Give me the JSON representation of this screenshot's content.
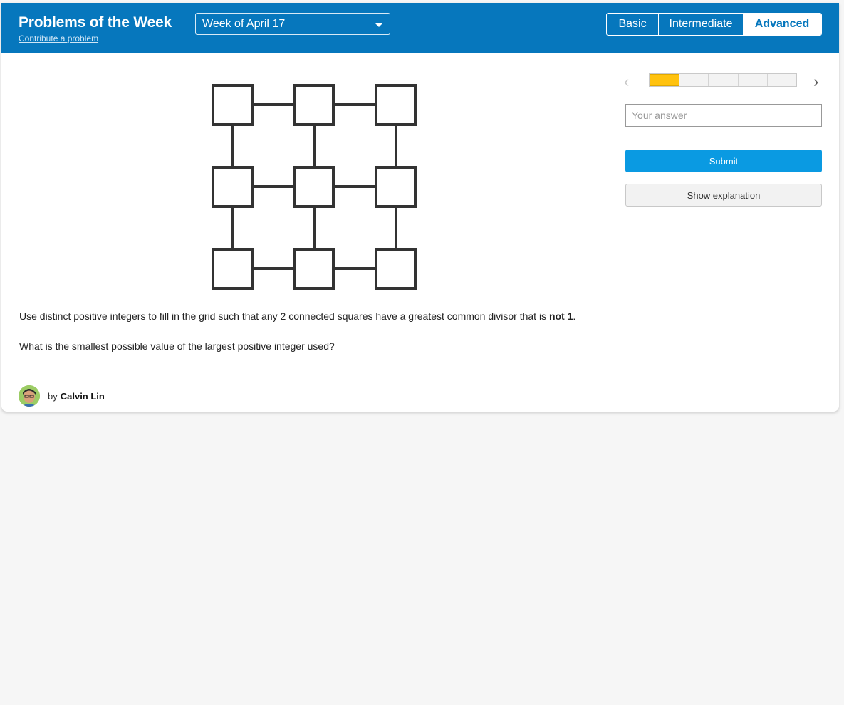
{
  "header": {
    "title": "Problems of the Week",
    "contribute_link": "Contribute a problem",
    "week_select": {
      "selected": "Week of April 17"
    },
    "levels": [
      {
        "label": "Basic",
        "active": false
      },
      {
        "label": "Intermediate",
        "active": false
      },
      {
        "label": "Advanced",
        "active": true
      }
    ],
    "colors": {
      "header_bg": "#0677bd",
      "active_level_text": "#0677bd"
    }
  },
  "problem": {
    "statement_pre": "Use distinct positive integers to fill in the grid such that any 2 connected squares have a greatest common divisor that is ",
    "statement_bold": "not 1",
    "statement_post": ".",
    "question": "What is the smallest possible value of the largest positive integer used?",
    "author_prefix": "by",
    "author": "Calvin Lin"
  },
  "sidebar": {
    "progress": {
      "segments": 5,
      "current": 1,
      "active_color": "#ffc20e"
    },
    "answer_placeholder": "Your answer",
    "submit_label": "Submit",
    "explanation_label": "Show explanation",
    "submit_color": "#0a9ae2"
  }
}
